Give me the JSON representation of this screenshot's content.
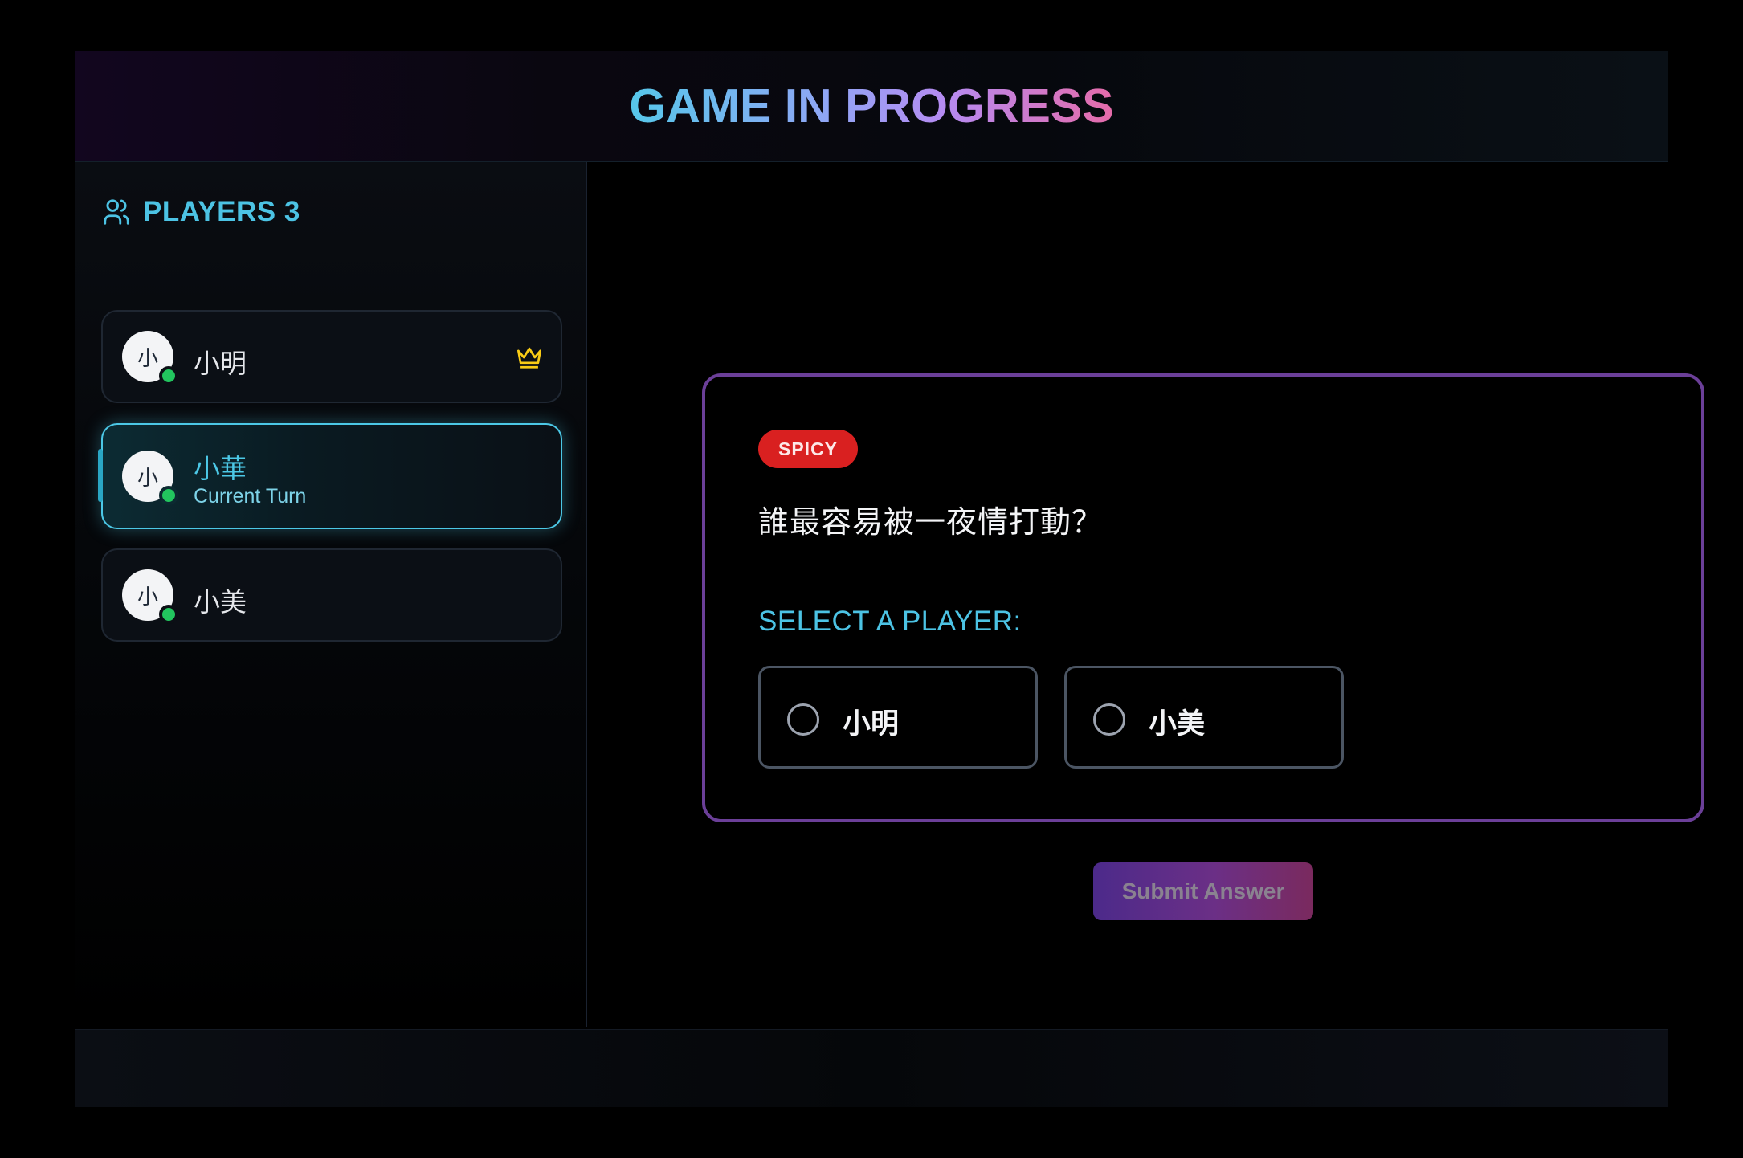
{
  "header": {
    "title": "GAME IN PROGRESS"
  },
  "sidebar": {
    "title": "PLAYERS 3",
    "icon": "users-icon",
    "players": [
      {
        "initial": "小",
        "name": "小明",
        "online": true,
        "host": true
      },
      {
        "initial": "小",
        "name": "小華",
        "subtitle": "Current Turn",
        "online": true,
        "active": true
      },
      {
        "initial": "小",
        "name": "小美",
        "online": true
      }
    ]
  },
  "question": {
    "badge": "SPICY",
    "text": "誰最容易被一夜情打動？",
    "select_label": "SELECT A PLAYER:",
    "options": [
      {
        "label": "小明",
        "selected": false
      },
      {
        "label": "小美",
        "selected": false
      }
    ]
  },
  "submit_label": "Submit Answer",
  "colors": {
    "accent": "#4cc8e6",
    "badge": "#d92020",
    "card_border": "#6b3f98",
    "online": "#22c55e",
    "crown": "#facc15"
  }
}
